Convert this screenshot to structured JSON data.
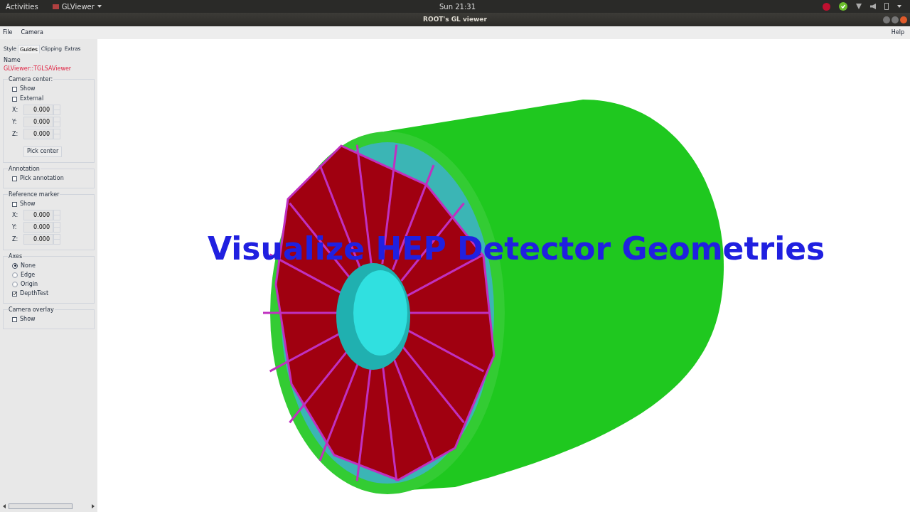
{
  "top_bar": {
    "activities": "Activities",
    "app_menu": "GLViewer",
    "clock": "Sun 21:31"
  },
  "window": {
    "title": "ROOT's GL viewer"
  },
  "menu": {
    "left": [
      "File",
      "Camera"
    ],
    "right": "Help"
  },
  "tabs": [
    {
      "label": "Style",
      "selected": false
    },
    {
      "label": "Guides",
      "selected": true
    },
    {
      "label": "Clipping",
      "selected": false
    },
    {
      "label": "Extras",
      "selected": false
    }
  ],
  "name": {
    "label": "Name",
    "value": "GLViewer::TGLSAViewer"
  },
  "groups": [
    {
      "title": "Camera center:",
      "items": [
        {
          "kind": "checkbox",
          "label": "Show",
          "checked": false
        },
        {
          "kind": "checkbox",
          "label": "External",
          "checked": false
        },
        {
          "kind": "number",
          "label": "X:",
          "value": "0.000"
        },
        {
          "kind": "number",
          "label": "Y:",
          "value": "0.000"
        },
        {
          "kind": "number",
          "label": "Z:",
          "value": "0.000"
        },
        {
          "kind": "button",
          "label": "Pick center"
        }
      ]
    },
    {
      "title": "Annotation",
      "items": [
        {
          "kind": "checkbox",
          "label": "Pick annotation",
          "checked": false
        }
      ]
    },
    {
      "title": "Reference marker",
      "items": [
        {
          "kind": "checkbox",
          "label": "Show",
          "checked": false
        },
        {
          "kind": "number",
          "label": "X:",
          "value": "0.000"
        },
        {
          "kind": "number",
          "label": "Y:",
          "value": "0.000"
        },
        {
          "kind": "number",
          "label": "Z:",
          "value": "0.000"
        }
      ]
    },
    {
      "title": "Axes",
      "items": [
        {
          "kind": "radio",
          "label": "None",
          "selected": true
        },
        {
          "kind": "radio",
          "label": "Edge",
          "selected": false
        },
        {
          "kind": "radio",
          "label": "Origin",
          "selected": false
        },
        {
          "kind": "checkbox",
          "label": "DepthTest",
          "checked": true
        }
      ]
    },
    {
      "title": "Camera overlay",
      "items": [
        {
          "kind": "checkbox",
          "label": "Show",
          "checked": false
        }
      ]
    }
  ],
  "viewer": {
    "caption": "Visualize HEP Detector Geometries"
  }
}
